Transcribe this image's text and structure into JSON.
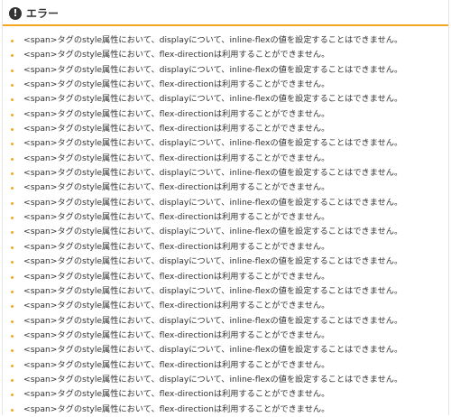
{
  "panel": {
    "icon": "exclamation-circle-icon",
    "icon_glyph": "!",
    "title": "エラー",
    "accent_color": "#f5a623"
  },
  "errors": [
    "<span>タグのstyle属性において、displayについて、inline-flexの値を設定することはできません。",
    "<span>タグのstyle属性において、flex-directionは利用することができません。",
    "<span>タグのstyle属性において、displayについて、inline-flexの値を設定することはできません。",
    "<span>タグのstyle属性において、flex-directionは利用することができません。",
    "<span>タグのstyle属性において、displayについて、inline-flexの値を設定することはできません。",
    "<span>タグのstyle属性において、flex-directionは利用することができません。",
    "<span>タグのstyle属性において、flex-directionは利用することができません。",
    "<span>タグのstyle属性において、displayについて、inline-flexの値を設定することはできません。",
    "<span>タグのstyle属性において、flex-directionは利用することができません。",
    "<span>タグのstyle属性において、displayについて、inline-flexの値を設定することはできません。",
    "<span>タグのstyle属性において、flex-directionは利用することができません。",
    "<span>タグのstyle属性において、displayについて、inline-flexの値を設定することはできません。",
    "<span>タグのstyle属性において、flex-directionは利用することができません。",
    "<span>タグのstyle属性において、displayについて、inline-flexの値を設定することはできません。",
    "<span>タグのstyle属性において、flex-directionは利用することができません。",
    "<span>タグのstyle属性において、displayについて、inline-flexの値を設定することはできません。",
    "<span>タグのstyle属性において、flex-directionは利用することができません。",
    "<span>タグのstyle属性において、displayについて、inline-flexの値を設定することはできません。",
    "<span>タグのstyle属性において、flex-directionは利用することができません。",
    "<span>タグのstyle属性において、displayについて、inline-flexの値を設定することはできません。",
    "<span>タグのstyle属性において、flex-directionは利用することができません。",
    "<span>タグのstyle属性において、displayについて、inline-flexの値を設定することはできません。",
    "<span>タグのstyle属性において、flex-directionは利用することができません。",
    "<span>タグのstyle属性において、displayについて、inline-flexの値を設定することはできません。",
    "<span>タグのstyle属性において、flex-directionは利用することができません。",
    "<span>タグのstyle属性において、flex-directionは利用することができません。"
  ]
}
